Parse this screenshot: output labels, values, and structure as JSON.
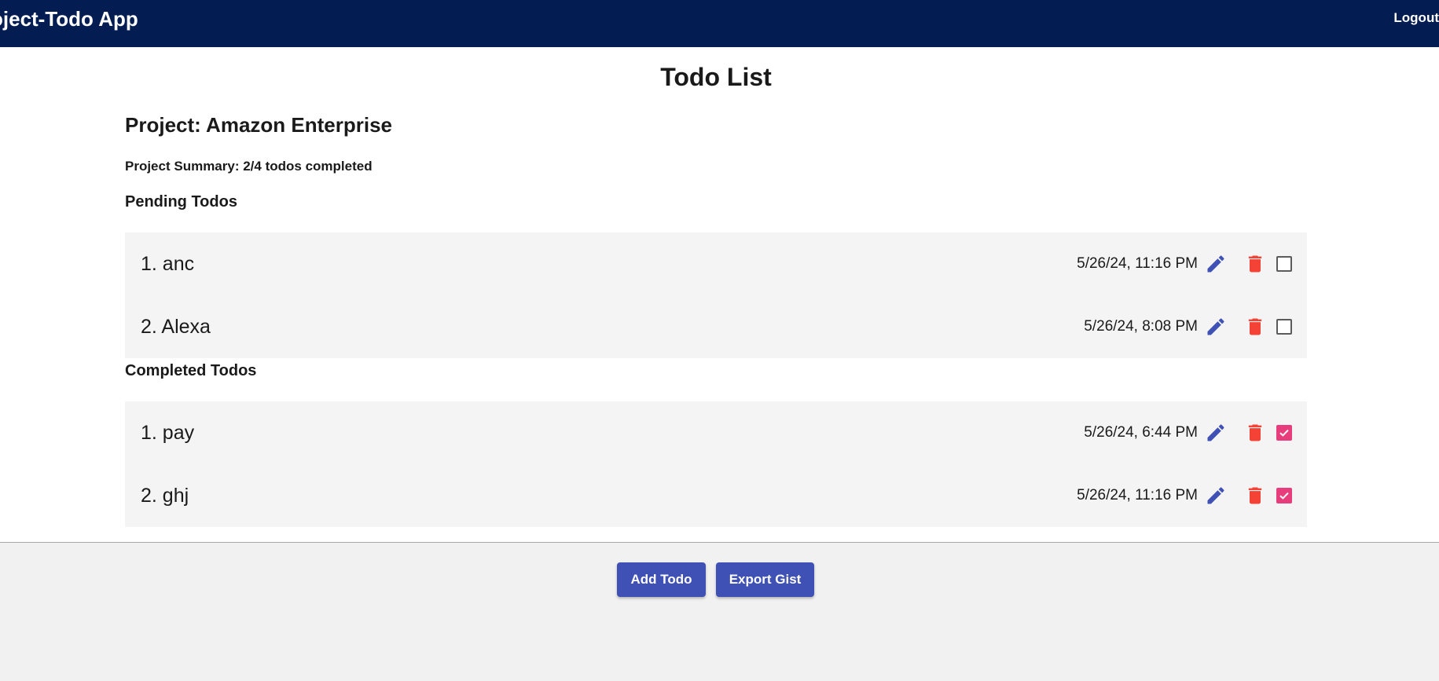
{
  "header": {
    "app_title": "oject-Todo App",
    "logout_label": "Logout"
  },
  "main": {
    "page_title": "Todo List",
    "project_label": "Project: Amazon Enterprise",
    "summary": "Project Summary: 2/4 todos completed",
    "pending_heading": "Pending Todos",
    "completed_heading": "Completed Todos",
    "pending": [
      {
        "label": "1. anc",
        "date": "5/26/24, 11:16 PM",
        "completed": false
      },
      {
        "label": "2. Alexa",
        "date": "5/26/24, 8:08 PM",
        "completed": false
      }
    ],
    "completed": [
      {
        "label": "1. pay",
        "date": "5/26/24, 6:44 PM",
        "completed": true
      },
      {
        "label": "2. ghj",
        "date": "5/26/24, 11:16 PM",
        "completed": true
      }
    ]
  },
  "footer": {
    "add_label": "Add Todo",
    "export_label": "Export Gist"
  },
  "icons": {
    "edit": "pencil-icon",
    "delete": "trash-icon",
    "checkbox_checked": "checkmark-icon"
  },
  "colors": {
    "appbar": "#031d52",
    "primary": "#3f51b5",
    "delete": "#f44336",
    "checked": "#e83d7c",
    "list_bg": "#f4f4f4",
    "footer_bg": "#f1f1f1"
  }
}
